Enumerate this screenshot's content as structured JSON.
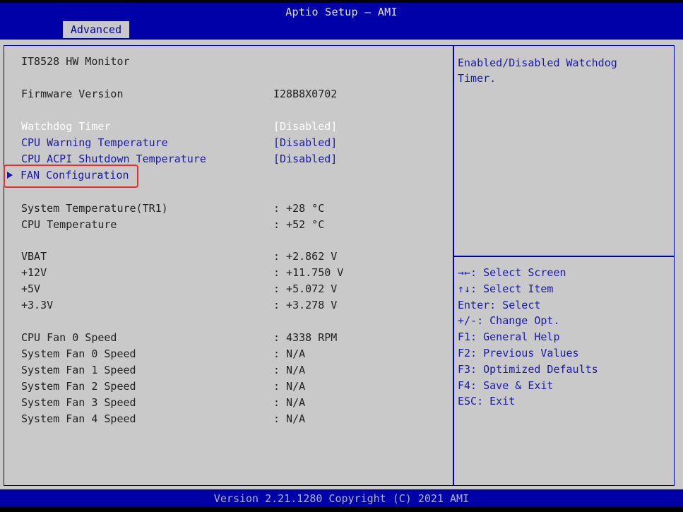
{
  "app": {
    "title": "Aptio Setup – AMI"
  },
  "tabs": [
    {
      "label": "Advanced"
    }
  ],
  "page": {
    "heading": "IT8528 HW Monitor"
  },
  "firmware": {
    "label": "Firmware Version",
    "value": "I28B8X0702"
  },
  "settings": [
    {
      "label": "Watchdog Timer",
      "value": "[Disabled]"
    },
    {
      "label": "CPU Warning Temperature",
      "value": "[Disabled]"
    },
    {
      "label": "CPU ACPI Shutdown Temperature",
      "value": "[Disabled]"
    }
  ],
  "submenu": {
    "label": "FAN Configuration"
  },
  "temperatures": [
    {
      "label": "System Temperature(TR1)",
      "value": ": +28 °C"
    },
    {
      "label": "CPU Temperature",
      "value": ": +52 °C"
    }
  ],
  "voltages": [
    {
      "label": "VBAT",
      "value": ": +2.862 V"
    },
    {
      "label": "+12V",
      "value": ": +11.750 V"
    },
    {
      "label": "+5V",
      "value": ": +5.072 V"
    },
    {
      "label": "+3.3V",
      "value": ": +3.278 V"
    }
  ],
  "fans": [
    {
      "label": "CPU Fan 0 Speed",
      "value": ": 4338 RPM"
    },
    {
      "label": "System Fan 0 Speed",
      "value": ": N/A"
    },
    {
      "label": "System Fan 1 Speed",
      "value": ": N/A"
    },
    {
      "label": "System Fan 2 Speed",
      "value": ": N/A"
    },
    {
      "label": "System Fan 3 Speed",
      "value": ": N/A"
    },
    {
      "label": "System Fan 4 Speed",
      "value": ": N/A"
    }
  ],
  "help": {
    "text": "Enabled/Disabled Watchdog\nTimer."
  },
  "keys": [
    "→←: Select Screen",
    "↑↓: Select Item",
    "Enter: Select",
    "+/-: Change Opt.",
    "F1: General Help",
    "F2: Previous Values",
    "F3: Optimized Defaults",
    "F4: Save & Exit",
    "ESC: Exit"
  ],
  "footer": {
    "text": "Version 2.21.1280 Copyright (C) 2021 AMI"
  },
  "colors": {
    "header_bg": "#0000a8",
    "panel_bg": "#c9c9c9",
    "option_text": "#1a1aa8",
    "selected_text": "#ffffff",
    "highlight_border": "#e23030"
  }
}
